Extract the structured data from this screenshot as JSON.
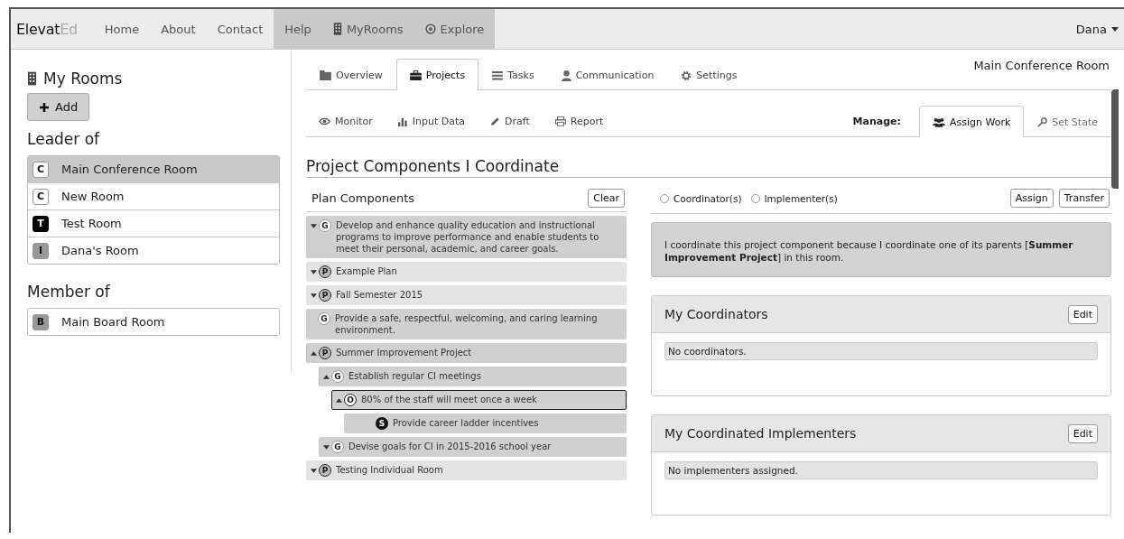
{
  "nav": {
    "brand": {
      "main": "Elevat",
      "accent": "Ed"
    },
    "items": [
      {
        "label": "Home",
        "highlighted": false
      },
      {
        "label": "About",
        "highlighted": false
      },
      {
        "label": "Contact",
        "highlighted": false
      },
      {
        "label": "Help",
        "highlighted": true
      },
      {
        "label": "MyRooms",
        "highlighted": true
      },
      {
        "label": "Explore",
        "highlighted": true
      }
    ],
    "user": "Dana"
  },
  "sidebar": {
    "title": "My Rooms",
    "add_button": "Add",
    "sections": [
      {
        "heading": "Leader of",
        "rooms": [
          {
            "badge": "C",
            "color": "#ffffff",
            "name": "Main Conference Room",
            "selected": true
          },
          {
            "badge": "C",
            "color": "#ffffff",
            "name": "New Room",
            "selected": false
          },
          {
            "badge": "T",
            "color": "#000000",
            "name": "Test Room",
            "selected": false
          },
          {
            "badge": "I",
            "color": "#999999",
            "name": "Dana's Room",
            "selected": false
          }
        ]
      },
      {
        "heading": "Member of",
        "rooms": [
          {
            "badge": "B",
            "color": "#999999",
            "name": "Main Board Room",
            "selected": false
          }
        ]
      }
    ]
  },
  "room_title": "Main Conference Room",
  "tabs": [
    {
      "label": "Overview",
      "selected": false
    },
    {
      "label": "Projects",
      "selected": true
    },
    {
      "label": "Tasks",
      "selected": false
    },
    {
      "label": "Communication",
      "selected": false
    },
    {
      "label": "Settings",
      "selected": false
    }
  ],
  "subtabs": [
    {
      "label": "Monitor"
    },
    {
      "label": "Input Data"
    },
    {
      "label": "Draft"
    },
    {
      "label": "Report"
    }
  ],
  "manage": {
    "label": "Manage:",
    "tabs": [
      {
        "label": "Assign Work",
        "selected": true
      },
      {
        "label": "Set State",
        "selected": false
      }
    ]
  },
  "heading": "Project Components I Coordinate",
  "plan": {
    "title": "Plan Components",
    "clear_button": "Clear",
    "items": [
      {
        "letter": "G",
        "expandable": true,
        "expanded": false,
        "selected": false,
        "text": "Develop and enhance quality education and instructional programs to improve performance and enable students to meet their personal, academic, and career goals."
      },
      {
        "letter": "P",
        "expandable": true,
        "expanded": false,
        "selected": false,
        "text": "Example Plan"
      },
      {
        "letter": "P",
        "expandable": true,
        "expanded": false,
        "selected": false,
        "text": "Fall Semester 2015"
      },
      {
        "letter": "G",
        "expandable": false,
        "expanded": false,
        "selected": false,
        "text": "Provide a safe, respectful, welcoming, and caring learning environment."
      },
      {
        "letter": "P",
        "expandable": true,
        "expanded": true,
        "selected": false,
        "text": "Summer Improvement Project",
        "children": [
          {
            "letter": "G",
            "expandable": true,
            "expanded": true,
            "selected": false,
            "text": "Establish regular CI meetings",
            "children": [
              {
                "letter": "O",
                "expandable": true,
                "expanded": true,
                "selected": true,
                "text": "80% of the staff will meet once a week",
                "children": [
                  {
                    "letter": "S",
                    "expandable": false,
                    "expanded": false,
                    "selected": false,
                    "text": "Provide career ladder incentives"
                  }
                ]
              }
            ]
          },
          {
            "letter": "G",
            "expandable": true,
            "expanded": false,
            "selected": false,
            "text": "Devise goals for CI in 2015-2016 school year"
          }
        ]
      },
      {
        "letter": "P",
        "expandable": true,
        "expanded": false,
        "selected": false,
        "text": "Testing Individual Room"
      }
    ]
  },
  "assign": {
    "options": [
      {
        "label": "Coordinator(s)",
        "selected": false
      },
      {
        "label": "Implementer(s)",
        "selected": false
      }
    ],
    "buttons": [
      "Assign",
      "Transfer"
    ],
    "info": "I coordinate this project component because I coordinate one of its parents [**Summer Improvement Project**] in this room.",
    "cards": [
      {
        "title": "My Coordinators",
        "button": "Edit",
        "empty_text": "No coordinators."
      },
      {
        "title": "My Coordinated Implementers",
        "button": "Edit",
        "empty_text": "No implementers assigned."
      }
    ]
  }
}
